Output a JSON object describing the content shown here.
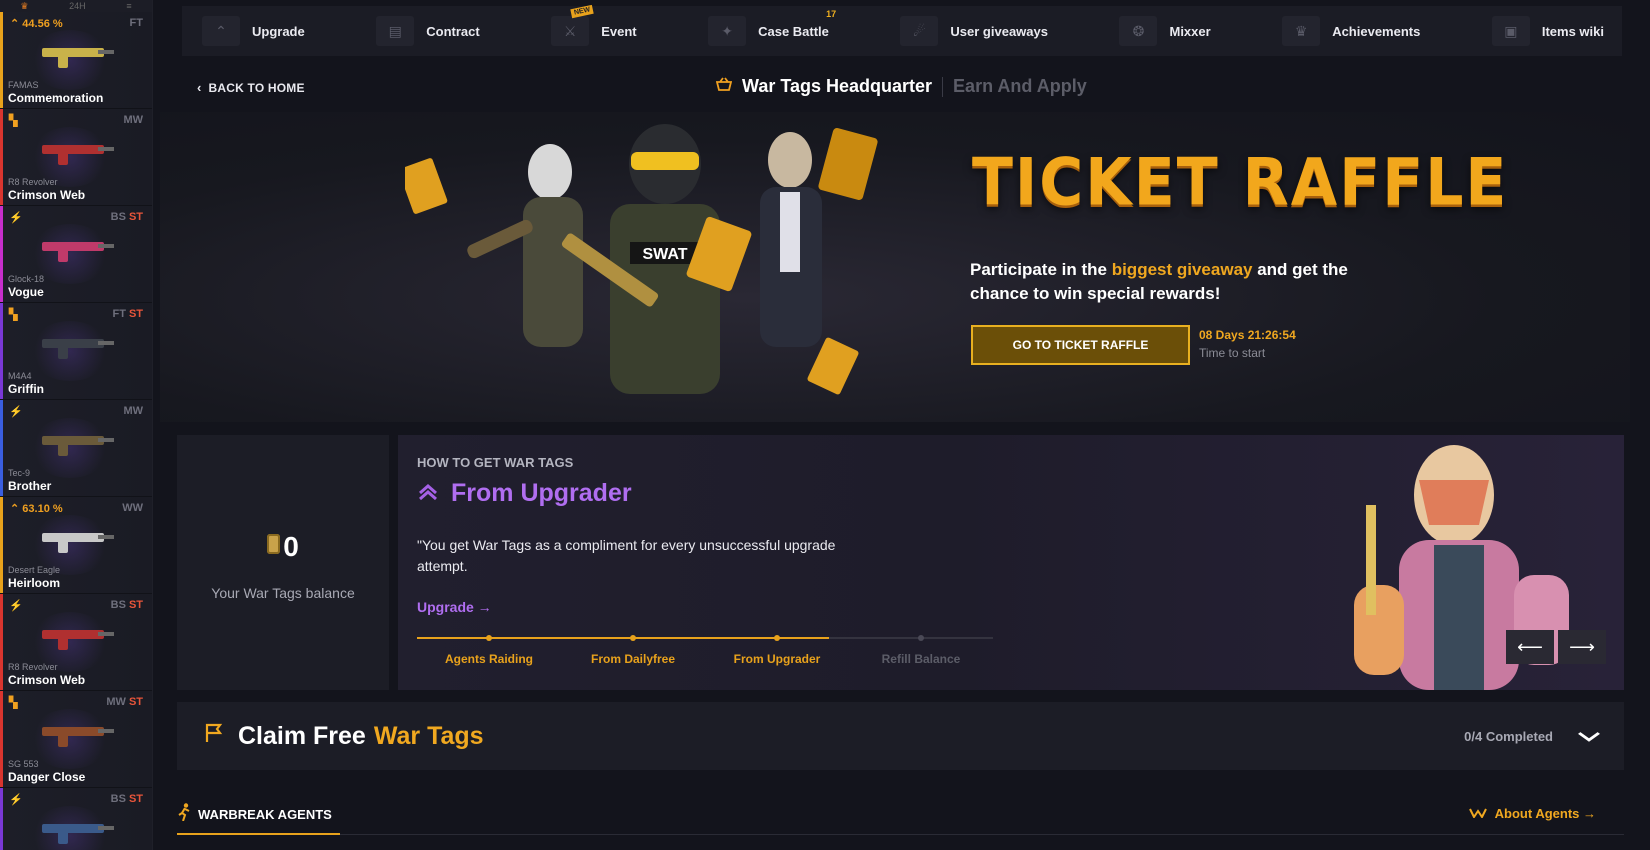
{
  "sidebar": {
    "top_tabs": [
      "24H"
    ],
    "drops": [
      {
        "badge": "44.56 %",
        "condition": "FT",
        "st": "",
        "weapon": "FAMAS",
        "skin": "Commemoration",
        "rarity": "orange",
        "color": "#c9b24a"
      },
      {
        "badge": "",
        "condition": "MW",
        "st": "",
        "weapon": "R8 Revolver",
        "skin": "Crimson Web",
        "rarity": "red",
        "color": "#b03030"
      },
      {
        "badge": "",
        "condition": "BS",
        "st": "ST",
        "weapon": "Glock-18",
        "skin": "Vogue",
        "rarity": "pink",
        "color": "#c03a6a"
      },
      {
        "badge": "",
        "condition": "FT",
        "st": "ST",
        "weapon": "M4A4",
        "skin": "Griffin",
        "rarity": "purple",
        "color": "#3a3f48"
      },
      {
        "badge": "",
        "condition": "MW",
        "st": "",
        "weapon": "Tec-9",
        "skin": "Brother",
        "rarity": "blue",
        "color": "#6a5a3a"
      },
      {
        "badge": "63.10 %",
        "condition": "WW",
        "st": "",
        "weapon": "Desert Eagle",
        "skin": "Heirloom",
        "rarity": "orange",
        "color": "#c8c8c8"
      },
      {
        "badge": "",
        "condition": "BS",
        "st": "ST",
        "weapon": "R8 Revolver",
        "skin": "Crimson Web",
        "rarity": "red",
        "color": "#b03030"
      },
      {
        "badge": "",
        "condition": "MW",
        "st": "ST",
        "weapon": "SG 553",
        "skin": "Danger Close",
        "rarity": "red",
        "color": "#8a4a2a"
      },
      {
        "badge": "",
        "condition": "BS",
        "st": "ST",
        "weapon": "",
        "skin": "",
        "rarity": "purple",
        "color": "#3a5a8a"
      }
    ]
  },
  "nav": {
    "items": [
      {
        "label": "Upgrade",
        "icon": "upgrade-arrow-icon",
        "new": false,
        "count": ""
      },
      {
        "label": "Contract",
        "icon": "document-icon",
        "new": false,
        "count": ""
      },
      {
        "label": "Event",
        "icon": "knife-icon",
        "new": true,
        "count": ""
      },
      {
        "label": "Case Battle",
        "icon": "battle-icon",
        "new": false,
        "count": "17"
      },
      {
        "label": "User giveaways",
        "icon": "giveaway-icon",
        "new": false,
        "count": ""
      },
      {
        "label": "Mixxer",
        "icon": "mixxer-icon",
        "new": false,
        "count": ""
      },
      {
        "label": "Achievements",
        "icon": "crown-icon",
        "new": false,
        "count": ""
      },
      {
        "label": "Items wiki",
        "icon": "wiki-icon",
        "new": false,
        "count": ""
      }
    ],
    "new_badge": "NEW"
  },
  "header": {
    "back": "BACK TO HOME",
    "title": "War Tags Headquarter",
    "subtitle": "Earn And Apply"
  },
  "hero": {
    "logo": "TICKET RAFFLE",
    "text_before": "Participate in the ",
    "text_highlight": "biggest giveaway",
    "text_after": " and get the chance to win special rewards!",
    "button": "GO TO TICKET RAFFLE",
    "countdown": "08 Days 21:26:54",
    "countdown_label": "Time to start"
  },
  "balance": {
    "amount": "0",
    "label": "Your War Tags balance"
  },
  "howto": {
    "kicker": "HOW TO GET WAR TAGS",
    "title": "From Upgrader",
    "description": "\"You get War Tags as a compliment for every unsuccessful upgrade attempt.",
    "link": "Upgrade →",
    "steps": [
      {
        "label": "Agents Raiding",
        "active": true
      },
      {
        "label": "From Dailyfree",
        "active": true
      },
      {
        "label": "From Upgrader",
        "active": true
      },
      {
        "label": "Refill Balance",
        "active": false
      }
    ],
    "progress_fraction": 0.715,
    "prev": "⟵",
    "next": "⟶"
  },
  "claim": {
    "title_white": "Claim Free",
    "title_gold": "War Tags",
    "progress": "0/4 Completed"
  },
  "agents": {
    "tab": "WARBREAK AGENTS",
    "about": "About Agents →"
  },
  "colors": {
    "accent_gold": "#f0a820",
    "accent_purple": "#b06ef0",
    "bg": "#13141c",
    "panel": "#1c1d26"
  }
}
